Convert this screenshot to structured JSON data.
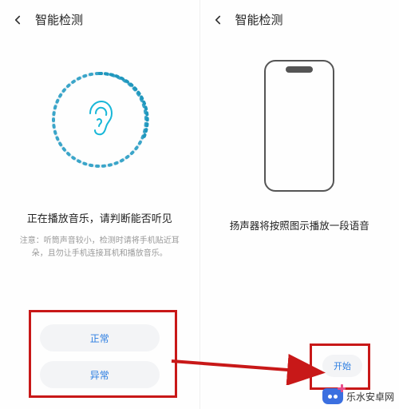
{
  "left": {
    "title": "智能检测",
    "status": "正在播放音乐，请判断能否听见",
    "note": "注意：听筒声音较小，检测时请将手机贴近耳朵，且勿让手机连接耳机和播放音乐。",
    "btn_normal": "正常",
    "btn_abnormal": "异常"
  },
  "right": {
    "title": "智能检测",
    "desc": "扬声器将按照图示播放一段语音",
    "btn_start": "开始"
  },
  "watermark": "乐水安卓网",
  "annotation_color": "#c81818"
}
